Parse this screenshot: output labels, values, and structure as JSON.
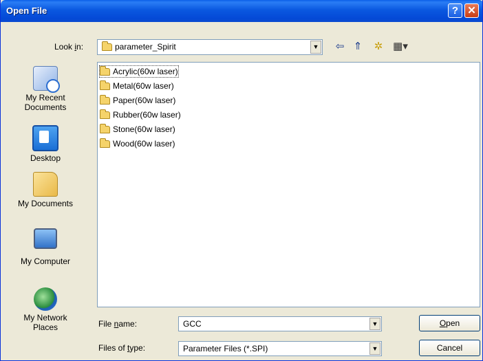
{
  "window": {
    "title": "Open File",
    "help": "?",
    "close": "✕"
  },
  "lookin": {
    "label_pre": "Look ",
    "label_u": "i",
    "label_post": "n:",
    "value": "parameter_Spirit"
  },
  "toolbar": {
    "back_icon": "⇦",
    "up_icon": "⇑",
    "newfolder_icon": "✲",
    "views_icon": "▦▾"
  },
  "sidebar": [
    {
      "label": "My Recent\nDocuments"
    },
    {
      "label": "Desktop"
    },
    {
      "label": "My Documents"
    },
    {
      "label": "My Computer"
    },
    {
      "label": "My Network\nPlaces"
    }
  ],
  "files": [
    "Acrylic(60w laser)",
    "Metal(60w laser)",
    "Paper(60w laser)",
    "Rubber(60w laser)",
    "Stone(60w laser)",
    "Wood(60w laser)"
  ],
  "file_name": {
    "label_pre": "File ",
    "label_u": "n",
    "label_post": "ame:",
    "value": "GCC"
  },
  "file_type": {
    "label_pre": "Files of ",
    "label_u": "t",
    "label_post": "ype:",
    "value": "Parameter Files (*.SPI)"
  },
  "buttons": {
    "open_u": "O",
    "open_rest": "pen",
    "cancel": "Cancel"
  },
  "colors": {
    "titlebar": "#0a58e0",
    "dialog_bg": "#ece9d8",
    "folder": "#f5d36a"
  }
}
